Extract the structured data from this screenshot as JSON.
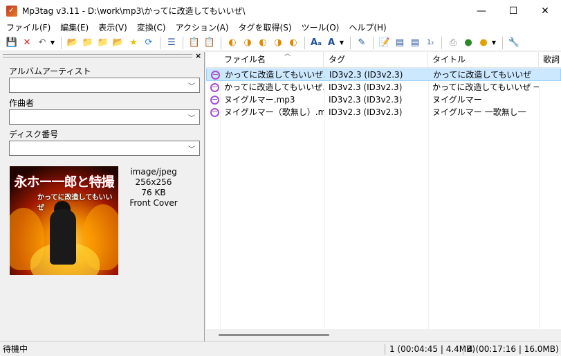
{
  "window": {
    "title": "Mp3tag v3.11  -  D:\\work\\mp3\\かってに改造してもいいぜ\\",
    "minimize": "—",
    "maximize": "☐",
    "close": "✕"
  },
  "menu": [
    "ファイル(F)",
    "編集(E)",
    "表示(V)",
    "変換(C)",
    "アクション(A)",
    "タグを取得(S)",
    "ツール(O)",
    "ヘルプ(H)"
  ],
  "toolbar": {
    "icons": [
      "save-icon",
      "delete-icon",
      "undo-icon",
      "change-directory-icon",
      "add-directory-icon",
      "favorite-directories-icon",
      "open-folder-icon",
      "favorites-star-icon",
      "refresh-icon",
      "playlist-icon",
      "cut-icon",
      "paste-icon",
      "tag-to-filename-icon",
      "filename-to-tag-icon",
      "text-file-to-tag-icon",
      "tag-to-tag-icon",
      "actions-icon",
      "case-conversion-icon",
      "format-value-icon",
      "extended-tags-icon",
      "edit-tags-icon",
      "export-icon",
      "filelist-icon",
      "autonumber-icon",
      "print-icon",
      "web-sources-icon",
      "web-sources-dropdown-icon",
      "options-icon"
    ]
  },
  "left_panel": {
    "close": "×",
    "fields": [
      {
        "label": "アルバムアーティスト",
        "value": ""
      },
      {
        "label": "作曲者",
        "value": ""
      },
      {
        "label": "ディスク番号",
        "value": ""
      }
    ],
    "cover": {
      "title_text": "永ホー一郎と特撮",
      "subtitle_text": "かってに改造してもいいぜ",
      "mime": "image/jpeg",
      "dimensions": "256x256",
      "size": "76 KB",
      "type": "Front Cover"
    }
  },
  "file_list": {
    "columns": [
      "ファイル名",
      "タグ",
      "タイトル",
      "歌詞"
    ],
    "rows": [
      {
        "filename": "かってに改造してもいいぜ....",
        "tag": "ID3v2.3 (ID3v2.3)",
        "title": "かってに改造してもいいぜ",
        "selected": true
      },
      {
        "filename": "かってに改造してもいいぜ....",
        "tag": "ID3v2.3 (ID3v2.3)",
        "title": "かってに改造してもいいぜ 一...",
        "selected": false
      },
      {
        "filename": "ヌイグルマー.mp3",
        "tag": "ID3v2.3 (ID3v2.3)",
        "title": "ヌイグルマー",
        "selected": false
      },
      {
        "filename": "ヌイグルマー（歌無し）.mp3",
        "tag": "ID3v2.3 (ID3v2.3)",
        "title": "ヌイグルマー 一歌無し一",
        "selected": false
      }
    ]
  },
  "status": {
    "state": "待機中",
    "selected": "1 (00:04:45 | 4.4MB)",
    "total": "4 (00:17:16 | 16.0MB)"
  },
  "colors": {
    "selection": "#cce8ff",
    "selection_border": "#99d1ff",
    "file_icon": "#a64ed4"
  }
}
